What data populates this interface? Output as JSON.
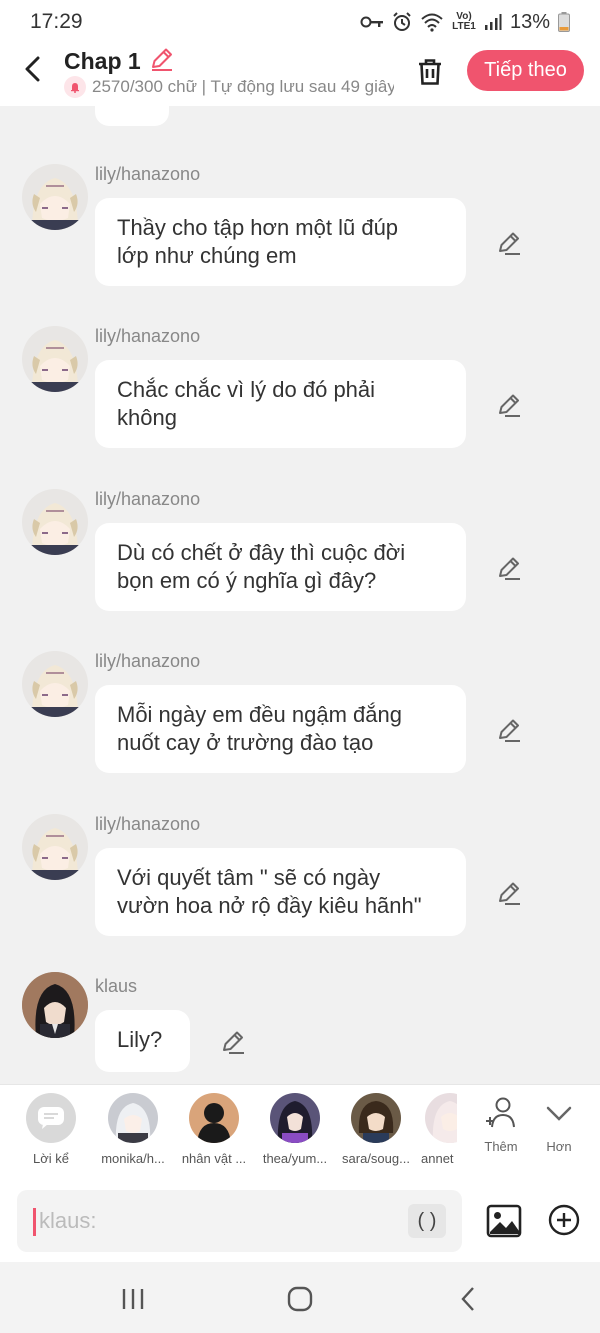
{
  "status": {
    "time": "17:29",
    "network": "Vo) LTE1",
    "battery": "13%"
  },
  "header": {
    "title": "Chap 1",
    "subtitle": "2570/300 chữ | Tự động lưu sau 49 giây",
    "next_label": "Tiếp theo"
  },
  "messages": [
    {
      "user": "lily/hanazono",
      "text": "Thầy cho tập hơn một lũ đúp\nlớp như chúng em"
    },
    {
      "user": "lily/hanazono",
      "text": "Chắc chắc vì lý do đó phải\nkhông"
    },
    {
      "user": "lily/hanazono",
      "text": "Dù có chết ở đây thì cuộc đời\nbọn em có ý nghĩa gì đây?"
    },
    {
      "user": "lily/hanazono",
      "text": "Mỗi ngày em đều ngậm đắng\nnuốt cay ở trường đào tạo"
    },
    {
      "user": "lily/hanazono",
      "text": "Với quyết tâm \" sẽ có ngày\nvườn hoa nở rộ đầy kiêu hãnh\""
    },
    {
      "user": "klaus",
      "text": "Lily?"
    }
  ],
  "toolbar": {
    "characters": [
      {
        "label": "Lời kể",
        "icon": "chat-bubble-icon"
      },
      {
        "label": "monika/h..."
      },
      {
        "label": "nhân vật ..."
      },
      {
        "label": "thea/yum..."
      },
      {
        "label": "sara/soug..."
      },
      {
        "label": "annet"
      }
    ],
    "add_label": "Thêm",
    "more_label": "Hơn"
  },
  "input": {
    "placeholder": "klaus:",
    "paren_label": "( )"
  },
  "colors": {
    "accent": "#f0546e",
    "background": "#f1f1f1"
  }
}
